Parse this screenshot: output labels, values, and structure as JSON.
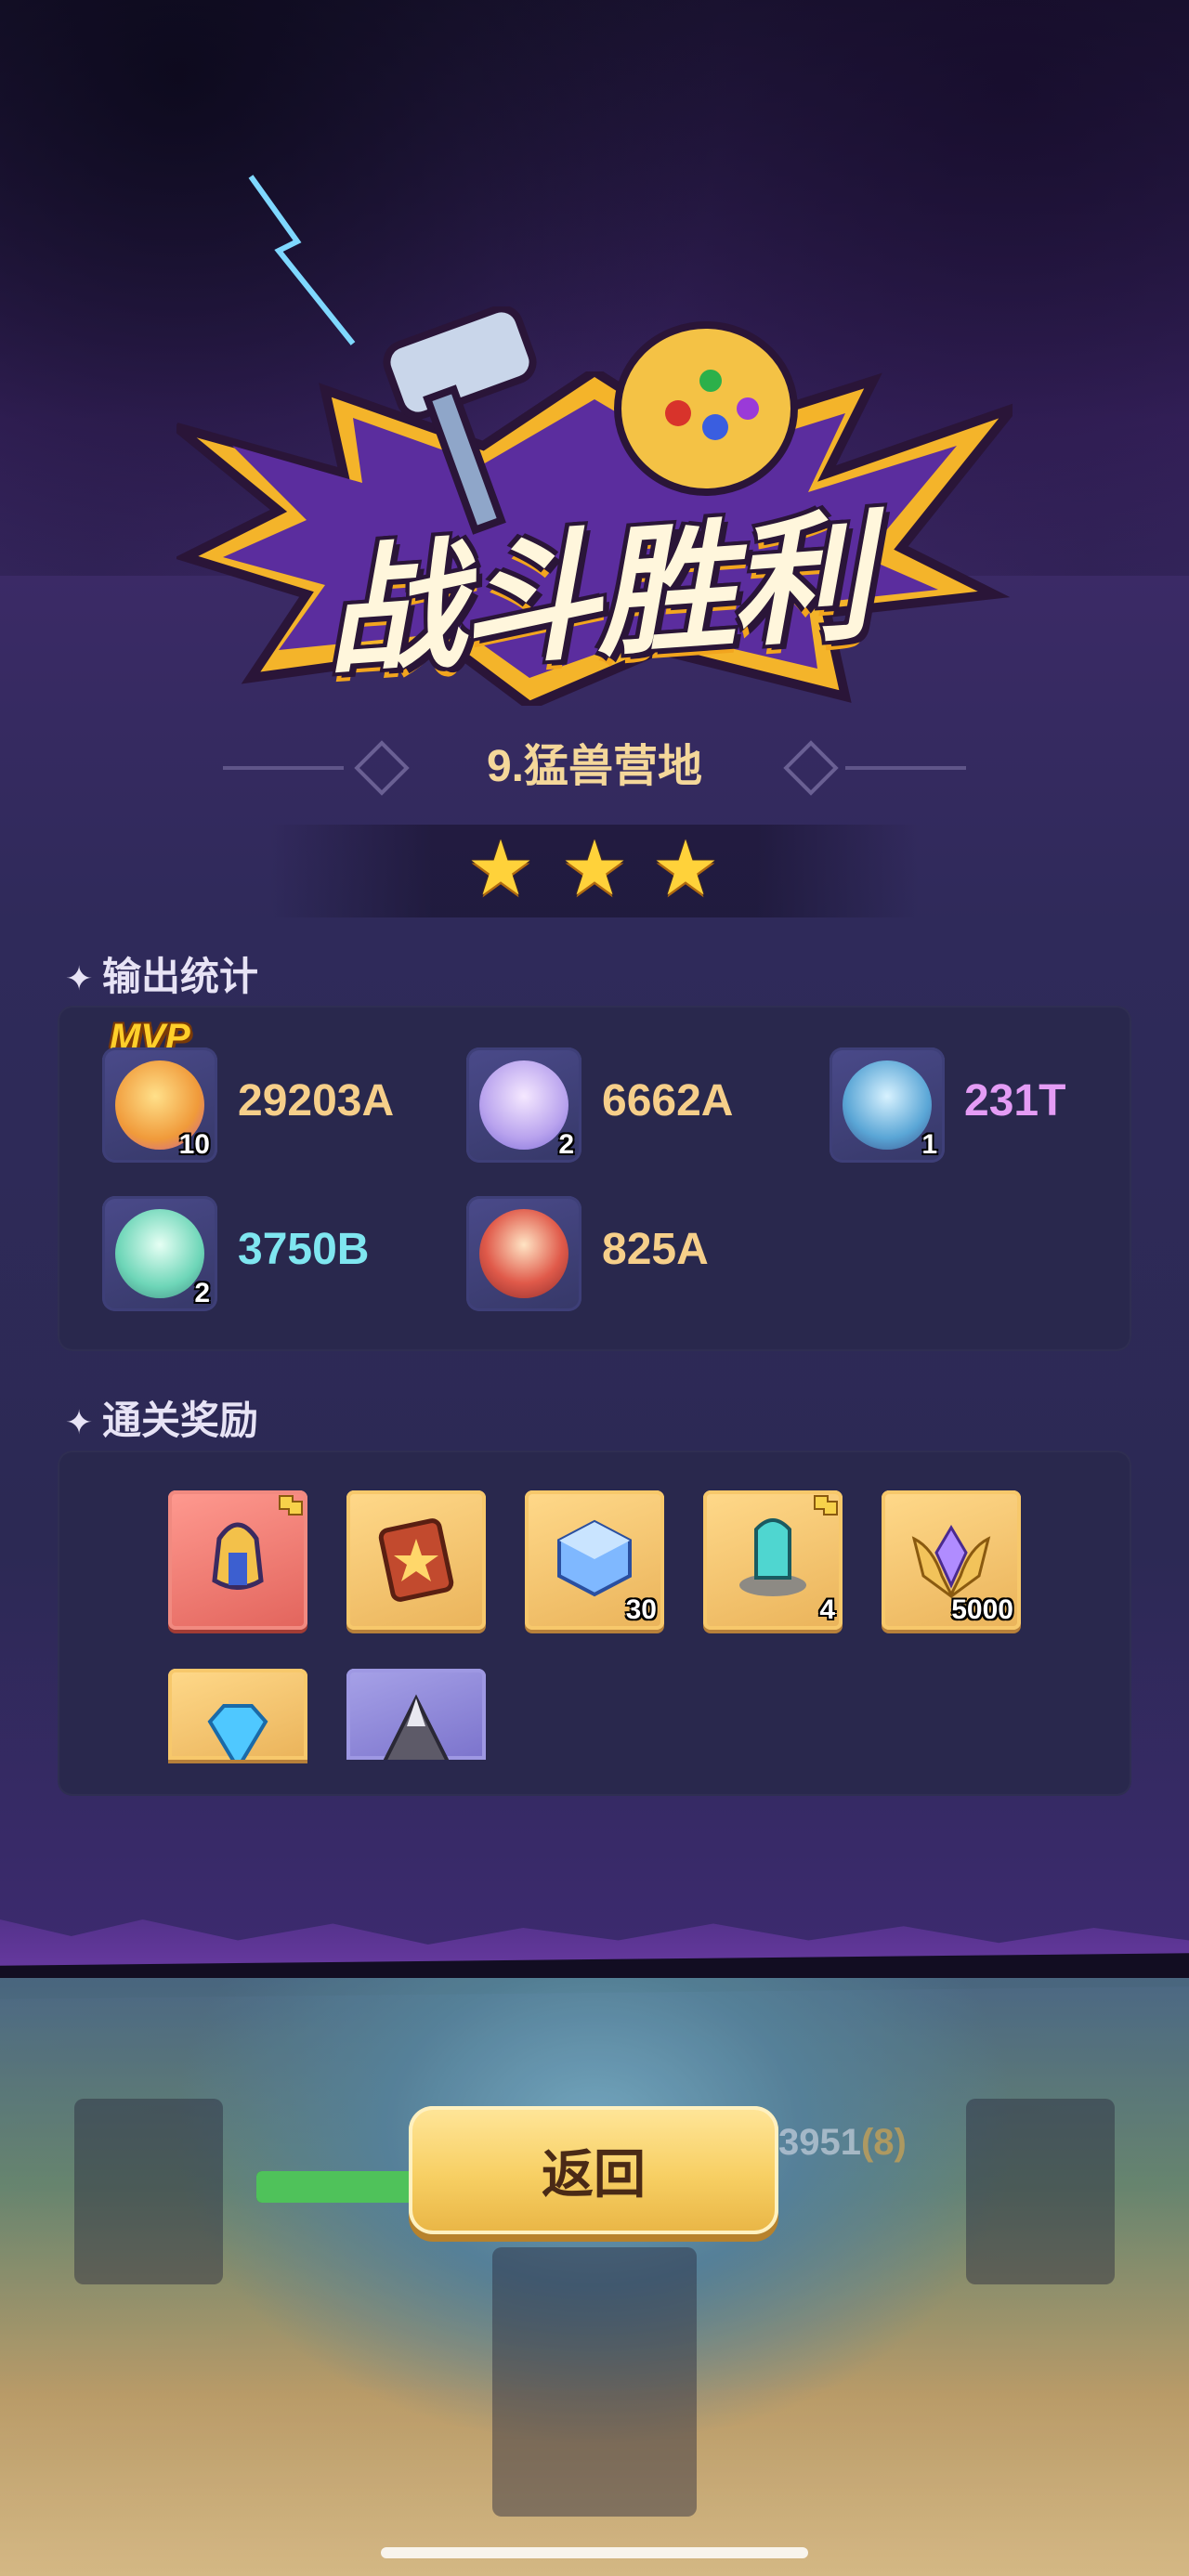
{
  "result": {
    "title": "战斗胜利",
    "stage_name": "9.猛兽营地",
    "stars_earned": 3
  },
  "damage_stats": {
    "heading": "输出统计",
    "mvp_label": "MVP",
    "heroes": [
      {
        "value": "29203A",
        "level": "10",
        "color": "#f6cf8a"
      },
      {
        "value": "6662A",
        "level": "2",
        "color": "#f6cf8a"
      },
      {
        "value": "231T",
        "level": "1",
        "color": "#e49cf5"
      },
      {
        "value": "3750B",
        "level": "2",
        "color": "#7fe6f0"
      },
      {
        "value": "825A",
        "level": "",
        "color": "#f6cf8a"
      }
    ]
  },
  "rewards": {
    "heading": "通关奖励",
    "items": [
      {
        "icon": "bell-staff-fragment-icon",
        "count": ""
      },
      {
        "icon": "spell-book-icon",
        "count": ""
      },
      {
        "icon": "blue-cube-icon",
        "count": "30"
      },
      {
        "icon": "crystal-tower-fragment-icon",
        "count": "4"
      },
      {
        "icon": "winged-gem-icon",
        "count": "5000"
      },
      {
        "icon": "diamond-icon",
        "count": ""
      },
      {
        "icon": "stone-shard-icon",
        "count": ""
      }
    ]
  },
  "background_scene": {
    "score_text": "3951",
    "score_paren": "(8)"
  },
  "actions": {
    "return_label": "返回"
  }
}
